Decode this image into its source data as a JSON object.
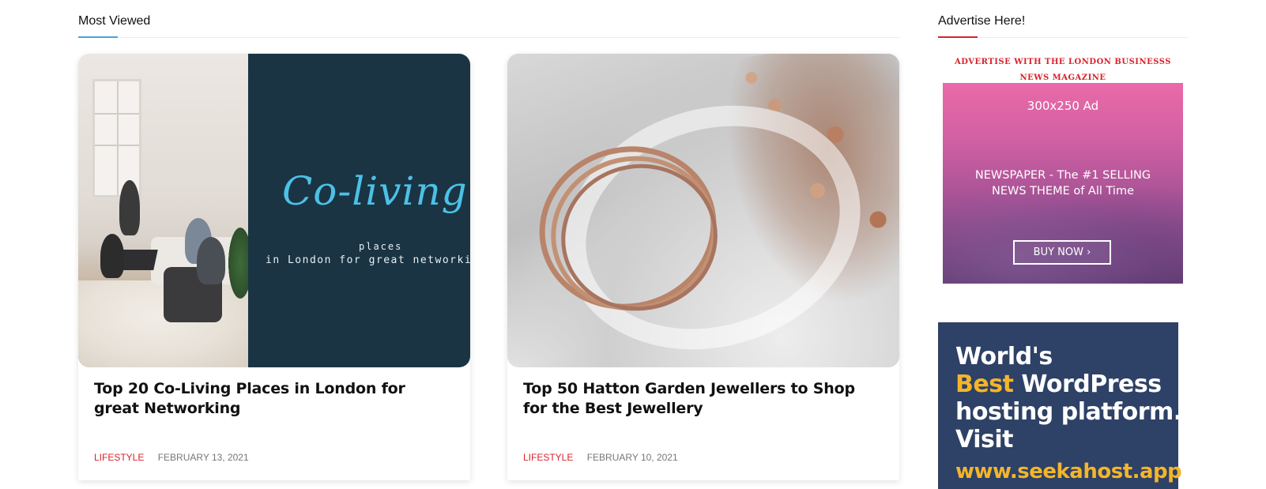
{
  "most_viewed": {
    "title": "Most Viewed",
    "posts": [
      {
        "title": "Top 20 Co-Living Places in London for great Networking",
        "category": "LIFESTYLE",
        "date": "FEBRUARY 13, 2021",
        "thumb": {
          "script_text": "Co-living",
          "line1": "places",
          "line2": "in London for great networkin"
        }
      },
      {
        "title": "Top 50 Hatton Garden Jewellers to Shop for the Best Jewellery",
        "category": "LIFESTYLE",
        "date": "FEBRUARY 10, 2021"
      }
    ]
  },
  "sidebar": {
    "title": "Advertise Here!",
    "ad_caption": "ADVERTISE WITH THE LONDON BUSINESSS NEWS MAGAZINE",
    "banner": {
      "size": "300x250 Ad",
      "headline": "NEWSPAPER - The #1 SELLING NEWS THEME of All Time",
      "button": "BUY NOW ›"
    },
    "hosting_ad": {
      "line1": "World's",
      "line2_highlight": "Best",
      "line2_rest": " WordPress",
      "line3": "hosting platform.",
      "line4": "Visit",
      "url": "www.seekahost.app"
    }
  },
  "colors": {
    "category": "#d9222a",
    "most_viewed_accent": "#4aa3d6",
    "advertise_accent": "#d9222a",
    "hosting_bg": "#2e4166",
    "hosting_highlight": "#f3b52b"
  }
}
